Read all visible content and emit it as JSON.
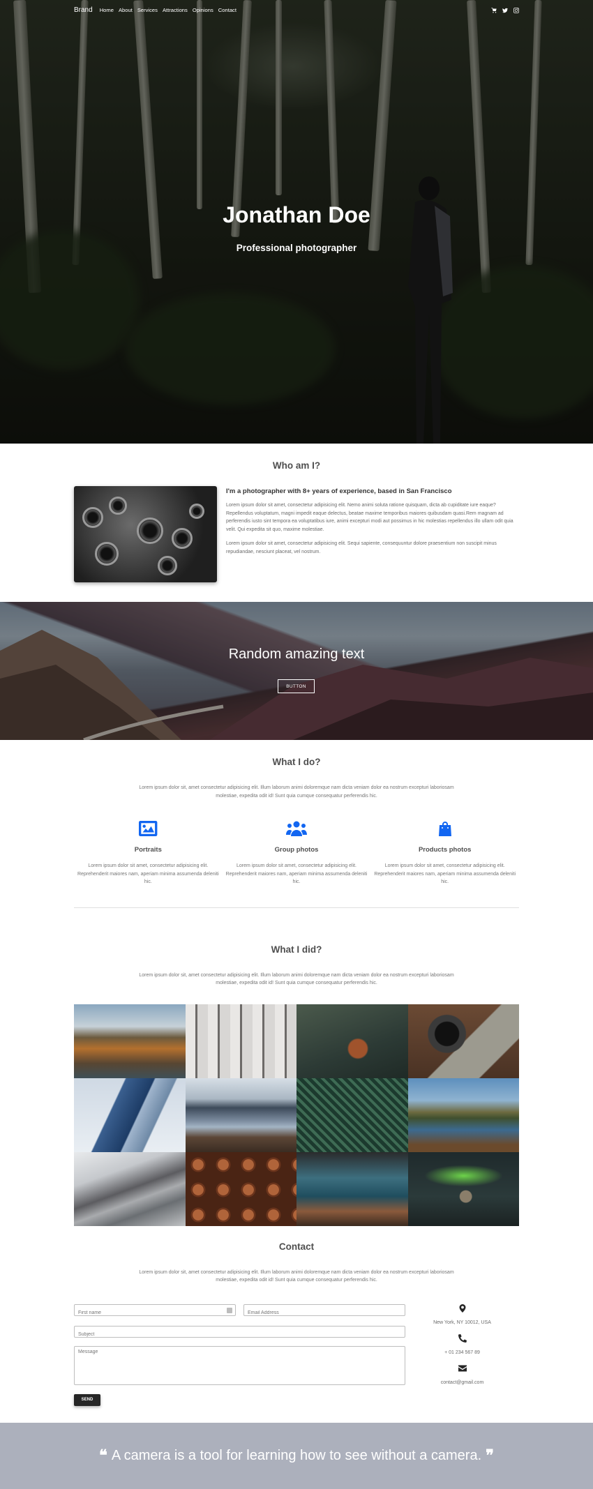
{
  "nav": {
    "brand": "Brand",
    "links": [
      "Home",
      "About",
      "Services",
      "Attractions",
      "Opinions",
      "Contact"
    ],
    "icons": [
      "cart-icon",
      "twitter-icon",
      "instagram-icon"
    ]
  },
  "hero": {
    "title": "Jonathan Doe",
    "subtitle": "Professional photographer"
  },
  "about": {
    "title": "Who am I?",
    "heading": "I'm a photographer with 8+ years of experience, based in San Francisco",
    "p1": "Lorem ipsum dolor sit amet, consectetur adipisicing elit. Nemo animi soluta ratione quisquam, dicta ab cupiditate iure eaque? Repellendus voluptatum, magni impedit eaque delectus, beatae maxime temporibus maiores quibusdam quasi.Rem magnam ad perferendis iusto sint tempora ea voluptatibus iure, animi excepturi modi aut possimus in hic molestias repellendus illo ullam odit quia velit. Qui expedita sit quo, maxime molestiae.",
    "p2": "Lorem ipsum dolor sit amet, consectetur adipisicing elit. Sequi sapiente, consequuntur dolore praesentium non suscipit minus repudiandae, nesciunt placeat, vel nostrum."
  },
  "banner": {
    "text": "Random amazing text",
    "button": "BUTTON"
  },
  "services": {
    "title": "What I do?",
    "lead": "Lorem ipsum dolor sit, amet consectetur adipisicing elit. Illum laborum animi doloremque nam dicta veniam dolor ea nostrum excepturi laboriosam molestiae, expedita odit id! Sunt quia cumque consequatur perferendis hic.",
    "items": [
      {
        "title": "Portraits",
        "icon": "image-icon",
        "text": "Lorem ipsum dolor sit amet, consectetur adipisicing elit. Reprehenderit maiores nam, aperiam minima assumenda deleniti hic."
      },
      {
        "title": "Group photos",
        "icon": "users-icon",
        "text": "Lorem ipsum dolor sit amet, consectetur adipisicing elit. Reprehenderit maiores nam, aperiam minima assumenda deleniti hic."
      },
      {
        "title": "Products photos",
        "icon": "shopping-bag-icon",
        "text": "Lorem ipsum dolor sit amet, consectetur adipisicing elit. Reprehenderit maiores nam, aperiam minima assumenda deleniti hic."
      }
    ]
  },
  "gallery": {
    "title": "What I did?",
    "lead": "Lorem ipsum dolor sit, amet consectetur adipisicing elit. Illum laborum animi doloremque nam dicta veniam dolor ea nostrum excepturi laboriosam molestiae, expedita odit id! Sunt quia cumque consequatur perferendis hic."
  },
  "contact": {
    "title": "Contact",
    "lead": "Lorem ipsum dolor sit, amet consectetur adipisicing elit. Illum laborum animi doloremque nam dicta veniam dolor ea nostrum excepturi laboriosam molestiae, expedita odit id! Sunt quia cumque consequatur perferendis hic.",
    "first_name_placeholder": "First name",
    "email_placeholder": "Email Address",
    "subject_placeholder": "Subject",
    "message_placeholder": "Message",
    "send_label": "SEND",
    "address": "New York, NY 10012, USA",
    "phone": "+ 01 234 567 89",
    "email": "contact@gmail.com"
  },
  "quote": {
    "text": "A camera is a tool for learning how to see without a camera."
  },
  "colors": {
    "accent": "#1266f1",
    "quote_bg": "#acb0bc",
    "dark_button": "#262626"
  }
}
